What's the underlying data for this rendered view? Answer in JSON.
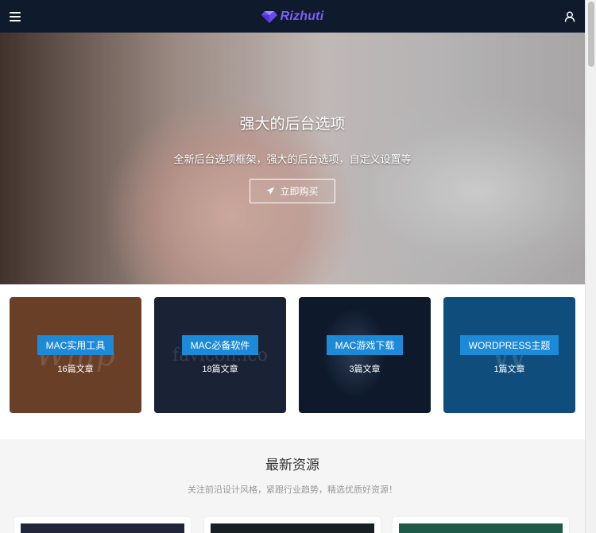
{
  "header": {
    "logo_text": "Rizhuti",
    "menu_icon": "hamburger-menu-icon",
    "logo_icon": "diamond-icon",
    "user_icon": "user-icon",
    "background_color": "#101a2d",
    "logo_color": "#7d5cff"
  },
  "hero": {
    "title": "强大的后台选项",
    "subtitle": "全新后台选项框架，强大的后台选项，自定义设置等",
    "button_label": "立即购买",
    "button_icon": "paper-plane-icon"
  },
  "categories": [
    {
      "label": "MAC实用工具",
      "count": "16篇文章",
      "bg_text": "Whip",
      "bg_color": "#6a3f28"
    },
    {
      "label": "MAC必备软件",
      "count": "18篇文章",
      "bg_text": "favicon.ico",
      "bg_color": "#1a2336"
    },
    {
      "label": "MAC游戏下载",
      "count": "3篇文章",
      "bg_text": "",
      "bg_color": "#0e1a2c"
    },
    {
      "label": "WORDPRESS主题",
      "count": "1篇文章",
      "bg_text": "W",
      "bg_color": "#0f4e7c"
    }
  ],
  "latest": {
    "title": "最新资源",
    "subtitle": "关注前沿设计风格，紧跟行业趋势，精选优质好资源！"
  },
  "accent_color": "#1d8ad8"
}
